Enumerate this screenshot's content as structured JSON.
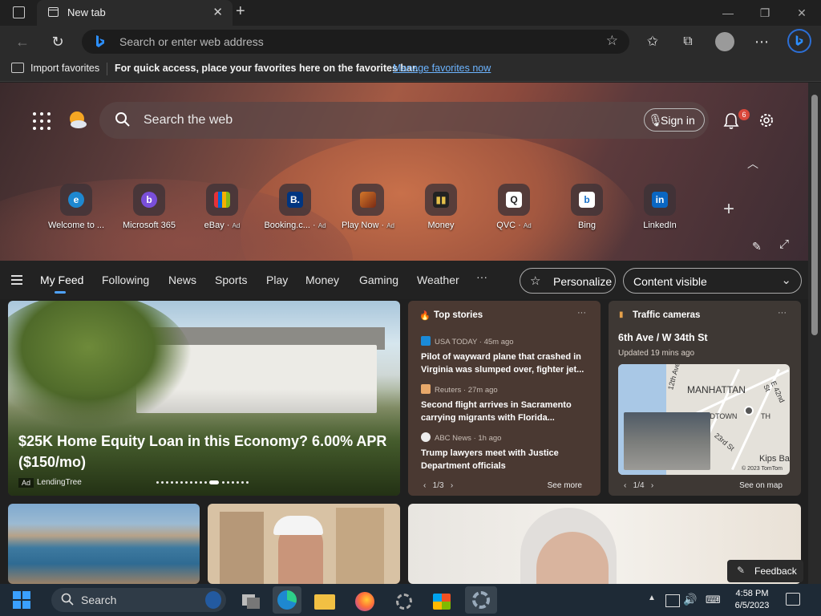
{
  "browser": {
    "tab_title": "New tab",
    "address_placeholder": "Search or enter web address",
    "favorites_bar": {
      "import_label": "Import favorites",
      "message": "For quick access, place your favorites here on the favorites bar.",
      "manage_link": "Manage favorites now"
    }
  },
  "hero": {
    "search_placeholder": "Search the web",
    "sign_in_label": "Sign in",
    "notification_count": "6",
    "quick_links": [
      {
        "label": "Welcome to ...",
        "ad": "",
        "icon": "edge-icon",
        "color": "#1e88d0"
      },
      {
        "label": "Microsoft 365",
        "ad": "",
        "icon": "m365-icon",
        "color": "#8b5cf6"
      },
      {
        "label": "eBay",
        "ad": "Ad",
        "icon": "ebay-icon",
        "color": "#e53238"
      },
      {
        "label": "Booking.c...",
        "ad": "Ad",
        "icon": "booking-icon",
        "color": "#003580"
      },
      {
        "label": "Play Now",
        "ad": "Ad",
        "icon": "game-icon",
        "color": "#b5451b"
      },
      {
        "label": "Money",
        "ad": "",
        "icon": "money-icon",
        "color": "#2a2a2a"
      },
      {
        "label": "QVC",
        "ad": "Ad",
        "icon": "qvc-icon",
        "color": "#ffffff"
      },
      {
        "label": "Bing",
        "ad": "",
        "icon": "bing-icon",
        "color": "#1870c8"
      },
      {
        "label": "LinkedIn",
        "ad": "",
        "icon": "linkedin-icon",
        "color": "#0a66c2"
      }
    ]
  },
  "feed_nav": {
    "items": [
      "My Feed",
      "Following",
      "News",
      "Sports",
      "Play",
      "Money",
      "Gaming",
      "Weather"
    ],
    "more": "···",
    "personalize": "Personalize",
    "content_visible": "Content visible"
  },
  "cards": {
    "main": {
      "headline": "$25K Home Equity Loan in this Economy? 6.00% APR ($150/mo)",
      "ad_tag": "Ad",
      "source": "LendingTree"
    },
    "top_stories": {
      "header": "Top stories",
      "stories": [
        {
          "source": "USA TODAY · 45m ago",
          "title": "Pilot of wayward plane that crashed in Virginia was slumped over, fighter jet...",
          "logo_color": "#1a8ad8"
        },
        {
          "source": "Reuters · 27m ago",
          "title": "Second flight arrives in Sacramento carrying migrants with Florida...",
          "logo_color": "#e8a86a"
        },
        {
          "source": "ABC News · 1h ago",
          "title": "Trump lawyers meet with Justice Department officials",
          "logo_color": "#eeeeee"
        }
      ],
      "pager": "1/3",
      "see_more": "See more"
    },
    "traffic": {
      "header": "Traffic cameras",
      "street": "6th Ave / W 34th St",
      "updated": "Updated 19 mins ago",
      "map_labels": [
        "MANHATTAN",
        "12th Ave",
        "E 42nd St",
        "23rd St",
        "IDTOWN",
        "TH",
        "Kips Ba",
        "© 2023 TomTom"
      ],
      "pager": "1/4",
      "see_map": "See on map"
    }
  },
  "feedback": "Feedback",
  "taskbar": {
    "search": "Search",
    "time": "4:58 PM",
    "date": "6/5/2023"
  }
}
